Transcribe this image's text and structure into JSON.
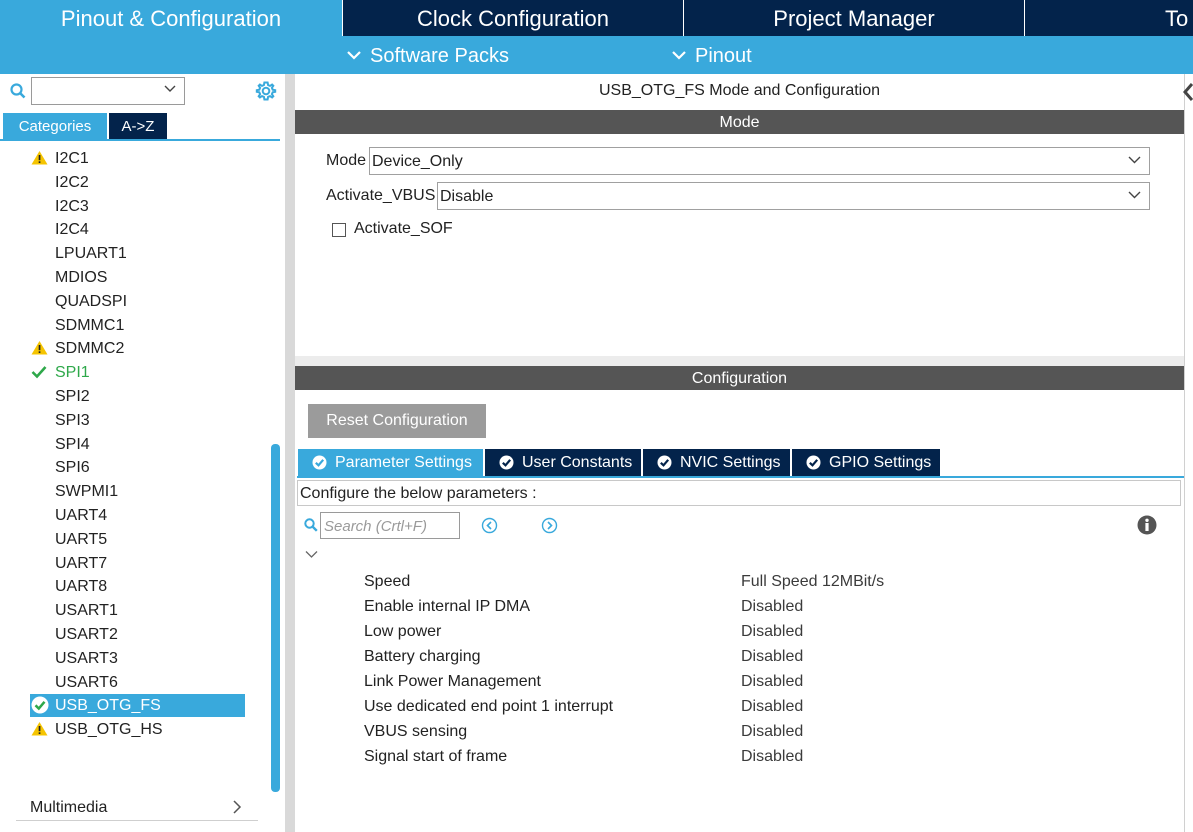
{
  "top_tabs": [
    {
      "label": "Pinout & Configuration",
      "active": true
    },
    {
      "label": "Clock Configuration",
      "active": false
    },
    {
      "label": "Project Manager",
      "active": false
    },
    {
      "label": "To",
      "active": false
    }
  ],
  "sub_menu": [
    {
      "label": "Software Packs"
    },
    {
      "label": "Pinout"
    }
  ],
  "left": {
    "search_value": "",
    "tabs": [
      {
        "label": "Categories"
      },
      {
        "label": "A->Z"
      }
    ],
    "peripherals": [
      {
        "label": "I2C1",
        "status": "warning"
      },
      {
        "label": "I2C2",
        "status": "none"
      },
      {
        "label": "I2C3",
        "status": "none"
      },
      {
        "label": "I2C4",
        "status": "none"
      },
      {
        "label": "LPUART1",
        "status": "none"
      },
      {
        "label": "MDIOS",
        "status": "none"
      },
      {
        "label": "QUADSPI",
        "status": "none"
      },
      {
        "label": "SDMMC1",
        "status": "none"
      },
      {
        "label": "SDMMC2",
        "status": "warning"
      },
      {
        "label": "SPI1",
        "status": "ok"
      },
      {
        "label": "SPI2",
        "status": "none"
      },
      {
        "label": "SPI3",
        "status": "none"
      },
      {
        "label": "SPI4",
        "status": "none"
      },
      {
        "label": "SPI6",
        "status": "none"
      },
      {
        "label": "SWPMI1",
        "status": "none"
      },
      {
        "label": "UART4",
        "status": "none"
      },
      {
        "label": "UART5",
        "status": "none"
      },
      {
        "label": "UART7",
        "status": "none"
      },
      {
        "label": "UART8",
        "status": "none"
      },
      {
        "label": "USART1",
        "status": "none"
      },
      {
        "label": "USART2",
        "status": "none"
      },
      {
        "label": "USART3",
        "status": "none"
      },
      {
        "label": "USART6",
        "status": "none"
      },
      {
        "label": "USB_OTG_FS",
        "status": "selected"
      },
      {
        "label": "USB_OTG_HS",
        "status": "warning"
      }
    ],
    "category_footer": "Multimedia"
  },
  "right": {
    "title": "USB_OTG_FS Mode and Configuration",
    "mode_header": "Mode",
    "mode_label": "Mode",
    "mode_value": "Device_Only",
    "vbus_label": "Activate_VBUS",
    "vbus_value": "Disable",
    "sof_label": "Activate_SOF",
    "sof_checked": false,
    "config_header": "Configuration",
    "reset_label": "Reset Configuration",
    "config_tabs": [
      {
        "label": "Parameter Settings",
        "active": true
      },
      {
        "label": "User Constants",
        "active": false
      },
      {
        "label": "NVIC Settings",
        "active": false
      },
      {
        "label": "GPIO Settings",
        "active": false
      }
    ],
    "configure_text": "Configure the below parameters :",
    "search_placeholder": "Search (Crtl+F)",
    "params": [
      {
        "name": "Speed",
        "value": "Full Speed 12MBit/s"
      },
      {
        "name": "Enable internal IP DMA",
        "value": "Disabled"
      },
      {
        "name": "Low power",
        "value": "Disabled"
      },
      {
        "name": "Battery charging",
        "value": "Disabled"
      },
      {
        "name": "Link Power Management",
        "value": "Disabled"
      },
      {
        "name": "Use dedicated end point 1 interrupt",
        "value": "Disabled"
      },
      {
        "name": "VBUS sensing",
        "value": "Disabled"
      },
      {
        "name": "Signal start of frame",
        "value": "Disabled"
      }
    ]
  },
  "colors": {
    "accent": "#39a9dc",
    "navy": "#03234b",
    "header_gray": "#555555",
    "warning": "#f5c400",
    "ok": "#2ea84a"
  }
}
